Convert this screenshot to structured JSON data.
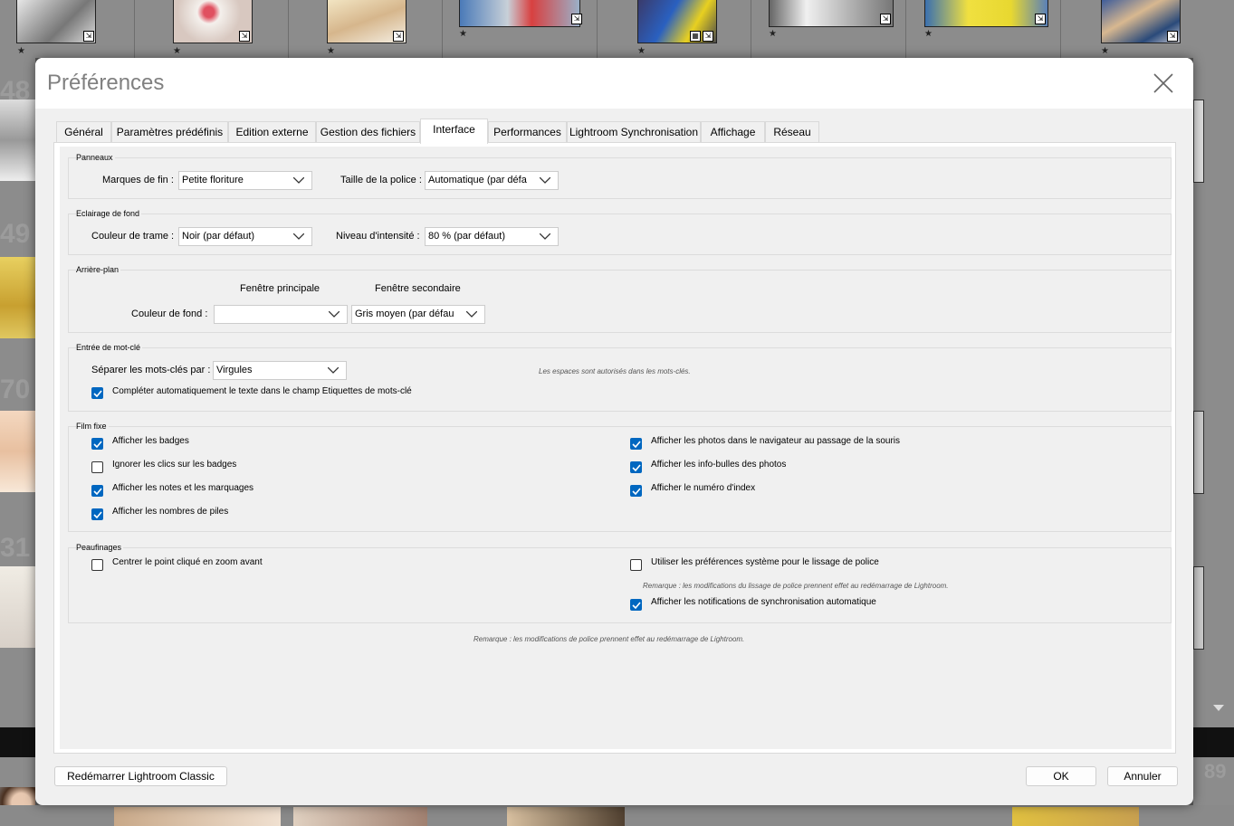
{
  "dialog": {
    "title": "Préférences",
    "tabs": [
      {
        "label": "Général"
      },
      {
        "label": "Paramètres prédéfinis"
      },
      {
        "label": "Edition externe"
      },
      {
        "label": "Gestion des fichiers"
      },
      {
        "label": "Interface"
      },
      {
        "label": "Performances"
      },
      {
        "label": "Lightroom Synchronisation"
      },
      {
        "label": "Affichage"
      },
      {
        "label": "Réseau"
      }
    ],
    "active_tab": "Interface"
  },
  "panneaux": {
    "title": "Panneaux",
    "end_marks_label": "Marques de fin :",
    "end_marks_value": "Petite floriture",
    "font_size_label": "Taille de la police :",
    "font_size_value": "Automatique (par défa"
  },
  "eclairage": {
    "title": "Eclairage de fond",
    "screen_color_label": "Couleur de trame :",
    "screen_color_value": "Noir (par défaut)",
    "intensity_label": "Niveau d'intensité :",
    "intensity_value": "80 % (par défaut)"
  },
  "arriere_plan": {
    "title": "Arrière-plan",
    "main_window_header": "Fenêtre principale",
    "secondary_window_header": "Fenêtre secondaire",
    "bg_color_label": "Couleur de fond :",
    "main_value": "",
    "secondary_value": "Gris moyen (par défau"
  },
  "mot_cle": {
    "title": "Entrée de mot-clé",
    "separator_label": "Séparer les mots-clés par :",
    "separator_value": "Virgules",
    "spaces_note": "Les espaces sont autorisés dans les mots-clés.",
    "autocomplete_label": "Compléter automatiquement le texte dans le champ Étiquettes de mots-clé",
    "autocomplete_checked": true
  },
  "film_fixe": {
    "title": "Film fixe",
    "left": [
      {
        "label": "Afficher les badges",
        "checked": true
      },
      {
        "label": "Ignorer les clics sur les badges",
        "checked": false
      },
      {
        "label": "Afficher les notes et les marquages",
        "checked": true
      },
      {
        "label": "Afficher les nombres de piles",
        "checked": true
      }
    ],
    "right": [
      {
        "label": "Afficher les photos dans le navigateur au passage de la souris",
        "checked": true
      },
      {
        "label": "Afficher les info-bulles des photos",
        "checked": true
      },
      {
        "label": "Afficher le numéro d'index",
        "checked": true
      }
    ]
  },
  "peaufinages": {
    "title": "Peaufinages",
    "zoom_label": "Centrer le point cliqué en zoom avant",
    "zoom_checked": false,
    "smoothing_label": "Utiliser les préférences système pour le lissage de police",
    "smoothing_checked": false,
    "smoothing_note": "Remarque : les modifications du lissage de police prennent effet au redémarrage de Lightroom.",
    "sync_label": "Afficher les notifications de synchronisation automatique",
    "sync_checked": true
  },
  "footer_note": "Remarque : les modifications de police prennent effet au redémarrage de Lightroom.",
  "buttons": {
    "restart": "Redémarrer Lightroom Classic",
    "ok": "OK",
    "cancel": "Annuler"
  },
  "background": {
    "grid_numbers": [
      "48",
      "49",
      "70",
      "31",
      "89"
    ]
  },
  "colors": {
    "checkbox_accent": "#0067c0",
    "dialog_bg": "#f0f0f0",
    "title_color": "#808080"
  }
}
